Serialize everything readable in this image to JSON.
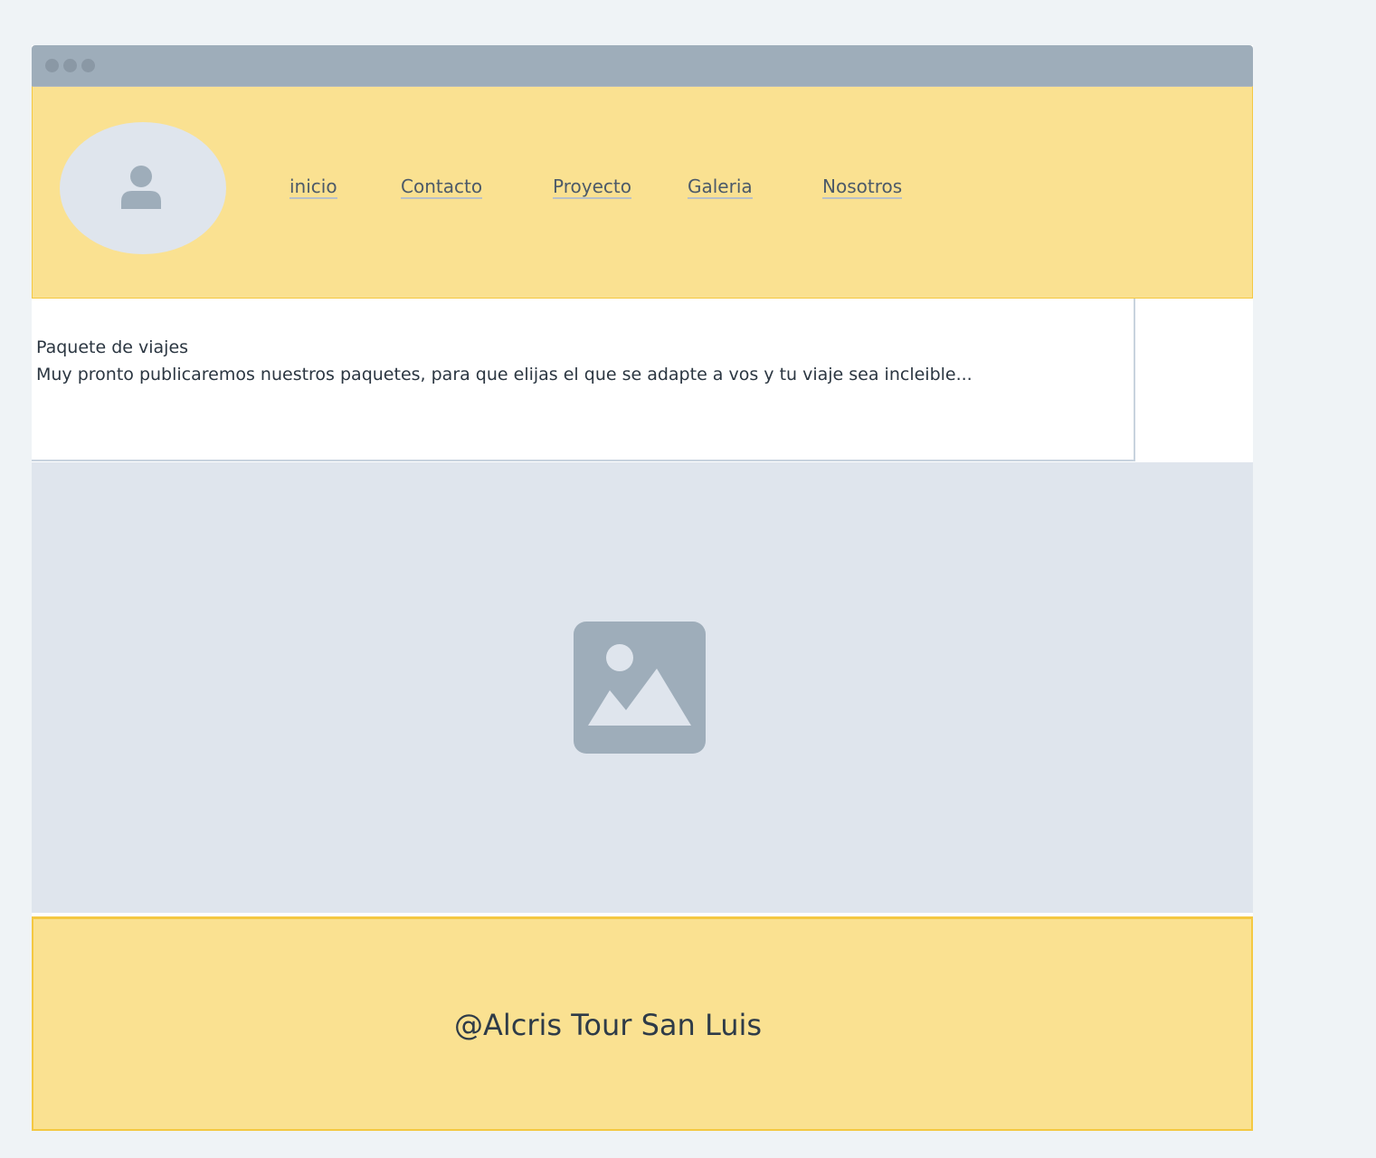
{
  "nav": {
    "items": [
      {
        "label": "inicio"
      },
      {
        "label": "Contacto"
      },
      {
        "label": "Proyecto"
      },
      {
        "label": "Galeria"
      },
      {
        "label": "Nosotros"
      }
    ]
  },
  "content": {
    "heading": "Paquete de viajes",
    "text": "Muy pronto publicaremos nuestros paquetes, para que elijas el que se adapte a vos y tu viaje sea incleible..."
  },
  "footer": {
    "brand": "@Alcris Tour San Luis"
  },
  "icons": {
    "avatar": "user-icon",
    "hero": "image-placeholder-icon"
  },
  "colors": {
    "header_bg": "#fae191",
    "accent_border": "#f4c842",
    "placeholder_bg": "#dfe5ed",
    "placeholder_icon": "#9eadba",
    "text": "#2b3641"
  }
}
